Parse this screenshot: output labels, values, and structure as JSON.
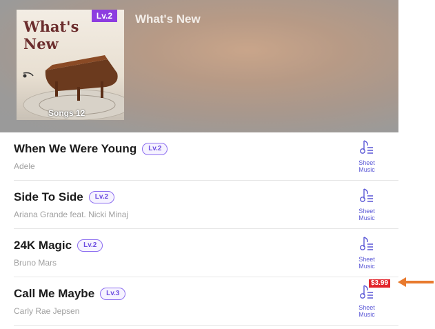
{
  "header": {
    "title": "What's New",
    "cover": {
      "text_line1": "What's",
      "text_line2": "New",
      "level": "Lv.2",
      "songs": "Songs 12"
    }
  },
  "sheet_music_label_line1": "Sheet",
  "sheet_music_label_line2": "Music",
  "songs": [
    {
      "title": "When We Were Young",
      "level": "Lv.2",
      "artist": "Adele"
    },
    {
      "title": "Side To Side",
      "level": "Lv.2",
      "artist": "Ariana Grande feat. Nicki Minaj"
    },
    {
      "title": "24K Magic",
      "level": "Lv.2",
      "artist": "Bruno Mars"
    },
    {
      "title": "Call Me Maybe",
      "level": "Lv.3",
      "artist": "Carly Rae Jepsen"
    }
  ],
  "price_tag": "$3.99",
  "colors": {
    "accent": "#5a57d6",
    "badge_border": "#8b6cf0",
    "price_bg": "#e2242b",
    "arrow": "#e87a2e"
  },
  "icons": [
    "music-note-icon",
    "arrow-left-icon"
  ]
}
